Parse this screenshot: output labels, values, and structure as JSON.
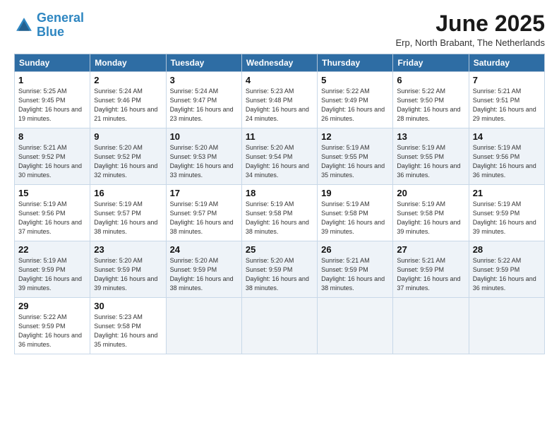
{
  "logo": {
    "line1": "General",
    "line2": "Blue"
  },
  "title": "June 2025",
  "subtitle": "Erp, North Brabant, The Netherlands",
  "weekdays": [
    "Sunday",
    "Monday",
    "Tuesday",
    "Wednesday",
    "Thursday",
    "Friday",
    "Saturday"
  ],
  "weeks": [
    [
      {
        "day": 1,
        "sunrise": "5:25 AM",
        "sunset": "9:45 PM",
        "daylight": "16 hours and 19 minutes."
      },
      {
        "day": 2,
        "sunrise": "5:24 AM",
        "sunset": "9:46 PM",
        "daylight": "16 hours and 21 minutes."
      },
      {
        "day": 3,
        "sunrise": "5:24 AM",
        "sunset": "9:47 PM",
        "daylight": "16 hours and 23 minutes."
      },
      {
        "day": 4,
        "sunrise": "5:23 AM",
        "sunset": "9:48 PM",
        "daylight": "16 hours and 24 minutes."
      },
      {
        "day": 5,
        "sunrise": "5:22 AM",
        "sunset": "9:49 PM",
        "daylight": "16 hours and 26 minutes."
      },
      {
        "day": 6,
        "sunrise": "5:22 AM",
        "sunset": "9:50 PM",
        "daylight": "16 hours and 28 minutes."
      },
      {
        "day": 7,
        "sunrise": "5:21 AM",
        "sunset": "9:51 PM",
        "daylight": "16 hours and 29 minutes."
      }
    ],
    [
      {
        "day": 8,
        "sunrise": "5:21 AM",
        "sunset": "9:52 PM",
        "daylight": "16 hours and 30 minutes."
      },
      {
        "day": 9,
        "sunrise": "5:20 AM",
        "sunset": "9:52 PM",
        "daylight": "16 hours and 32 minutes."
      },
      {
        "day": 10,
        "sunrise": "5:20 AM",
        "sunset": "9:53 PM",
        "daylight": "16 hours and 33 minutes."
      },
      {
        "day": 11,
        "sunrise": "5:20 AM",
        "sunset": "9:54 PM",
        "daylight": "16 hours and 34 minutes."
      },
      {
        "day": 12,
        "sunrise": "5:19 AM",
        "sunset": "9:55 PM",
        "daylight": "16 hours and 35 minutes."
      },
      {
        "day": 13,
        "sunrise": "5:19 AM",
        "sunset": "9:55 PM",
        "daylight": "16 hours and 36 minutes."
      },
      {
        "day": 14,
        "sunrise": "5:19 AM",
        "sunset": "9:56 PM",
        "daylight": "16 hours and 36 minutes."
      }
    ],
    [
      {
        "day": 15,
        "sunrise": "5:19 AM",
        "sunset": "9:56 PM",
        "daylight": "16 hours and 37 minutes."
      },
      {
        "day": 16,
        "sunrise": "5:19 AM",
        "sunset": "9:57 PM",
        "daylight": "16 hours and 38 minutes."
      },
      {
        "day": 17,
        "sunrise": "5:19 AM",
        "sunset": "9:57 PM",
        "daylight": "16 hours and 38 minutes."
      },
      {
        "day": 18,
        "sunrise": "5:19 AM",
        "sunset": "9:58 PM",
        "daylight": "16 hours and 38 minutes."
      },
      {
        "day": 19,
        "sunrise": "5:19 AM",
        "sunset": "9:58 PM",
        "daylight": "16 hours and 39 minutes."
      },
      {
        "day": 20,
        "sunrise": "5:19 AM",
        "sunset": "9:58 PM",
        "daylight": "16 hours and 39 minutes."
      },
      {
        "day": 21,
        "sunrise": "5:19 AM",
        "sunset": "9:59 PM",
        "daylight": "16 hours and 39 minutes."
      }
    ],
    [
      {
        "day": 22,
        "sunrise": "5:19 AM",
        "sunset": "9:59 PM",
        "daylight": "16 hours and 39 minutes."
      },
      {
        "day": 23,
        "sunrise": "5:20 AM",
        "sunset": "9:59 PM",
        "daylight": "16 hours and 39 minutes."
      },
      {
        "day": 24,
        "sunrise": "5:20 AM",
        "sunset": "9:59 PM",
        "daylight": "16 hours and 38 minutes."
      },
      {
        "day": 25,
        "sunrise": "5:20 AM",
        "sunset": "9:59 PM",
        "daylight": "16 hours and 38 minutes."
      },
      {
        "day": 26,
        "sunrise": "5:21 AM",
        "sunset": "9:59 PM",
        "daylight": "16 hours and 38 minutes."
      },
      {
        "day": 27,
        "sunrise": "5:21 AM",
        "sunset": "9:59 PM",
        "daylight": "16 hours and 37 minutes."
      },
      {
        "day": 28,
        "sunrise": "5:22 AM",
        "sunset": "9:59 PM",
        "daylight": "16 hours and 36 minutes."
      }
    ],
    [
      {
        "day": 29,
        "sunrise": "5:22 AM",
        "sunset": "9:59 PM",
        "daylight": "16 hours and 36 minutes."
      },
      {
        "day": 30,
        "sunrise": "5:23 AM",
        "sunset": "9:58 PM",
        "daylight": "16 hours and 35 minutes."
      },
      null,
      null,
      null,
      null,
      null
    ]
  ]
}
